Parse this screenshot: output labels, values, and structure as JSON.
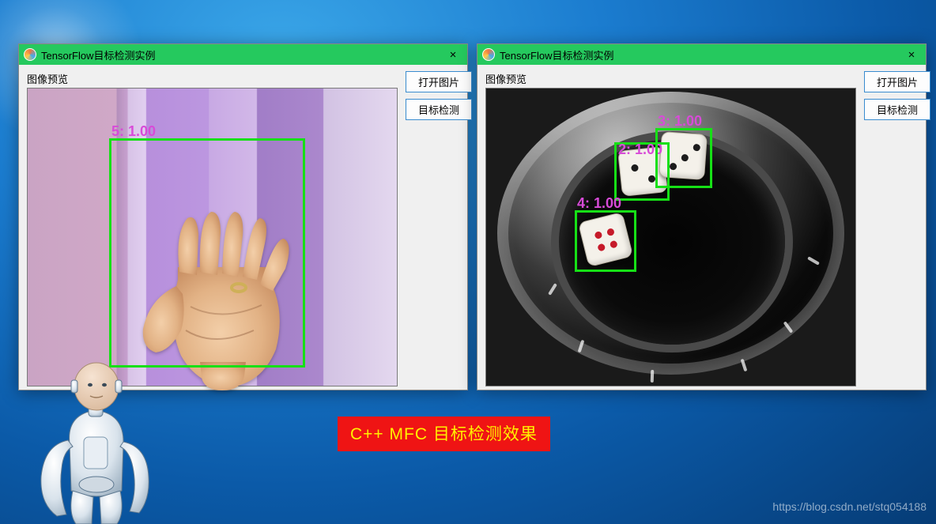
{
  "window1": {
    "title": "TensorFlow目标检测实例",
    "preview_label": "图像预览",
    "open_btn": "打开图片",
    "detect_btn": "目标检测",
    "detections": [
      {
        "label": "5:  1.00"
      }
    ]
  },
  "window2": {
    "title": "TensorFlow目标检测实例",
    "preview_label": "图像预览",
    "open_btn": "打开图片",
    "detect_btn": "目标检测",
    "detections": [
      {
        "label": "2:  1.00"
      },
      {
        "label": "3:  1.00"
      },
      {
        "label": "4:  1.00"
      }
    ]
  },
  "caption": "C++ MFC 目标检测效果",
  "watermark": "https://blog.csdn.net/stq054188"
}
